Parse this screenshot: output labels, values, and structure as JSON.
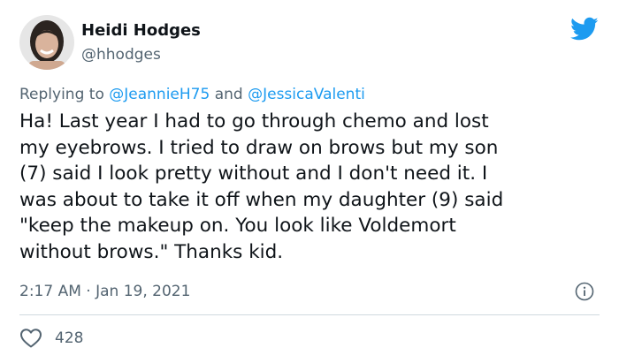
{
  "author": {
    "name": "Heidi Hodges",
    "handle": "@hhodges"
  },
  "reply": {
    "prefix": "Replying to",
    "mention1": "@JeannieH75",
    "conjunction": "and",
    "mention2": "@JessicaValenti"
  },
  "tweet_text": "Ha! Last year I had to go through chemo and lost\nmy eyebrows. I tried to draw on brows  but my son\n(7) said I look pretty without and I don't need it. I\nwas about to take it off when my daughter (9) said\n\"keep the makeup on. You look like Voldemort\nwithout brows.\" Thanks kid.",
  "meta": {
    "time": "2:17 AM",
    "separator": "·",
    "date": "Jan 19, 2021"
  },
  "likes": "428",
  "icons": {
    "brand": "twitter-bird-icon",
    "info": "info-icon",
    "like": "heart-icon"
  },
  "colors": {
    "brand": "#1d9bf0",
    "text": "#0f1419",
    "secondary": "#536471"
  }
}
